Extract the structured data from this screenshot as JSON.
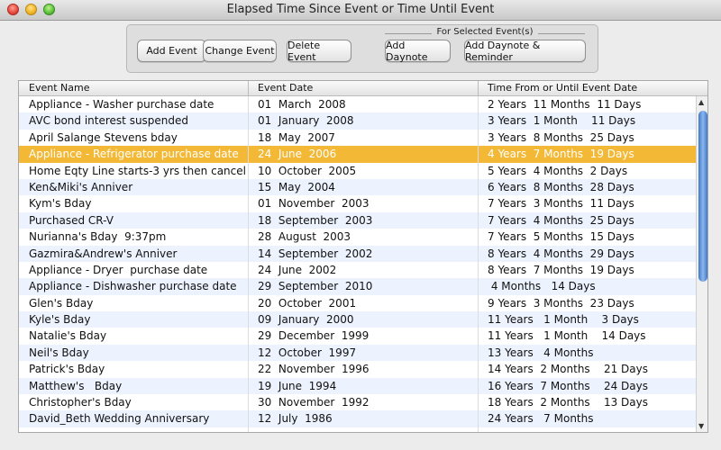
{
  "window": {
    "title": "Elapsed Time Since Event or Time Until Event"
  },
  "toolbar": {
    "add_label": "Add Event",
    "change_label": "Change Event",
    "delete_label": "Delete Event",
    "group_label": "For Selected Event(s)",
    "daynote_label": "Add Daynote",
    "daynote_reminder_label": "Add Daynote & Reminder"
  },
  "table": {
    "columns": [
      "Event Name",
      "Event Date",
      "Time From or Until Event Date"
    ],
    "selected_color": "#f3b835",
    "rows": [
      {
        "name": "Appliance - Washer purchase date",
        "date": "01  March  2008",
        "elapsed": "2 Years  11 Months  11 Days"
      },
      {
        "name": "AVC bond interest suspended",
        "date": "01  January  2008",
        "elapsed": "3 Years  1 Month    11 Days"
      },
      {
        "name": "April Salange Stevens bday",
        "date": "18  May  2007",
        "elapsed": "3 Years  8 Months  25 Days"
      },
      {
        "name": "Appliance - Refrigerator purchase date",
        "date": "24  June  2006",
        "elapsed": "4 Years  7 Months  19 Days",
        "selected": true
      },
      {
        "name": "Home Eqty Line starts-3 yrs then cancel",
        "date": "10  October  2005",
        "elapsed": "5 Years  4 Months  2 Days"
      },
      {
        "name": "Ken&Miki's Anniver",
        "date": "15  May  2004",
        "elapsed": "6 Years  8 Months  28 Days"
      },
      {
        "name": "Kym's Bday",
        "date": "01  November  2003",
        "elapsed": "7 Years  3 Months  11 Days"
      },
      {
        "name": "Purchased CR-V",
        "date": "18  September  2003",
        "elapsed": "7 Years  4 Months  25 Days"
      },
      {
        "name": "Nurianna's Bday  9:37pm",
        "date": "28  August  2003",
        "elapsed": "7 Years  5 Months  15 Days"
      },
      {
        "name": "Gazmira&Andrew's Anniver",
        "date": "14  September  2002",
        "elapsed": "8 Years  4 Months  29 Days"
      },
      {
        "name": "Appliance - Dryer  purchase date",
        "date": "24  June  2002",
        "elapsed": "8 Years  7 Months  19 Days"
      },
      {
        "name": "Appliance - Dishwasher purchase date",
        "date": "29  September  2010",
        "elapsed": " 4 Months   14 Days"
      },
      {
        "name": "Glen's Bday",
        "date": "20  October  2001",
        "elapsed": "9 Years  3 Months  23 Days"
      },
      {
        "name": "Kyle's Bday",
        "date": "09  January  2000",
        "elapsed": "11 Years   1 Month    3 Days"
      },
      {
        "name": "Natalie's Bday",
        "date": "29  December  1999",
        "elapsed": "11 Years   1 Month    14 Days"
      },
      {
        "name": "Neil's Bday",
        "date": "12  October  1997",
        "elapsed": "13 Years   4 Months"
      },
      {
        "name": "Patrick's Bday",
        "date": "22  November  1996",
        "elapsed": "14 Years  2 Months    21 Days"
      },
      {
        "name": "Matthew's   Bday",
        "date": "19  June  1994",
        "elapsed": "16 Years  7 Months    24 Days"
      },
      {
        "name": "Christopher's Bday",
        "date": "30  November  1992",
        "elapsed": "18 Years  2 Months    13 Days"
      },
      {
        "name": "David_Beth Wedding Anniversary",
        "date": "12  July  1986",
        "elapsed": "24 Years   7 Months"
      }
    ]
  }
}
